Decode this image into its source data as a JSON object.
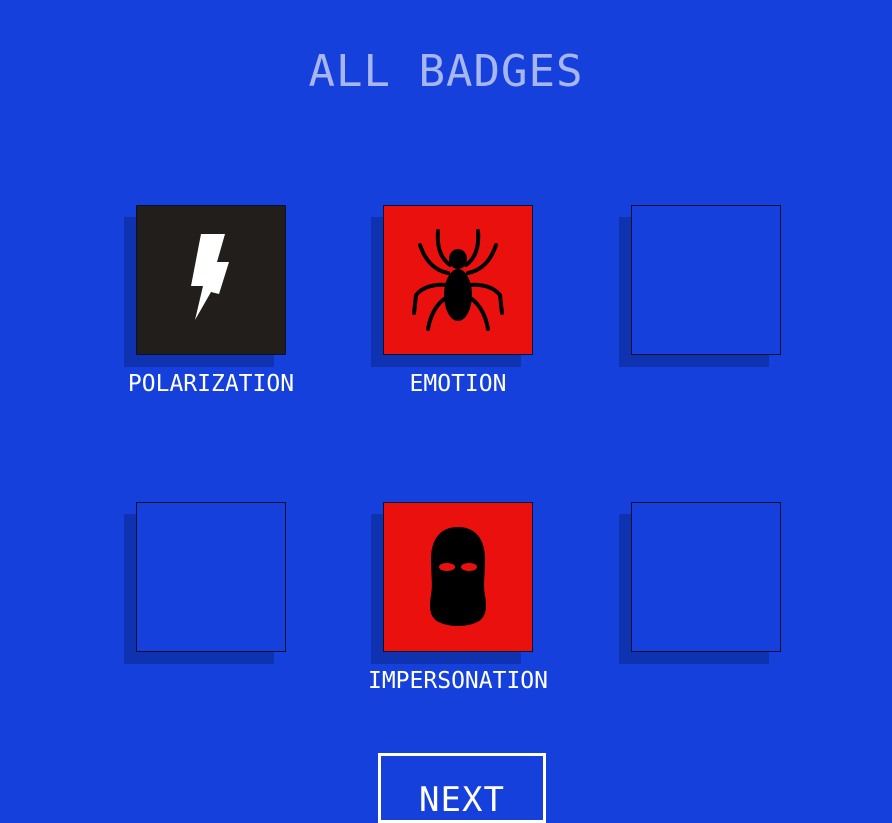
{
  "title": "ALL BADGES",
  "badges": [
    {
      "label": "POLARIZATION",
      "icon": "lightning-bolt-icon",
      "state": "unlocked",
      "background": "#211e1b"
    },
    {
      "label": "EMOTION",
      "icon": "spider-icon",
      "state": "unlocked",
      "background": "#ea100e"
    },
    {
      "label": "",
      "icon": "",
      "state": "locked",
      "background": "#1540dc"
    },
    {
      "label": "",
      "icon": "",
      "state": "locked",
      "background": "#1540dc"
    },
    {
      "label": "IMPERSONATION",
      "icon": "balaclava-mask-icon",
      "state": "unlocked",
      "background": "#ea100e"
    },
    {
      "label": "",
      "icon": "",
      "state": "locked",
      "background": "#1540dc"
    }
  ],
  "next_label": "NEXT",
  "colors": {
    "background": "#1540dc",
    "title": "#a8b6f0",
    "text": "#ffffff",
    "shadow": "#0f33b0"
  }
}
